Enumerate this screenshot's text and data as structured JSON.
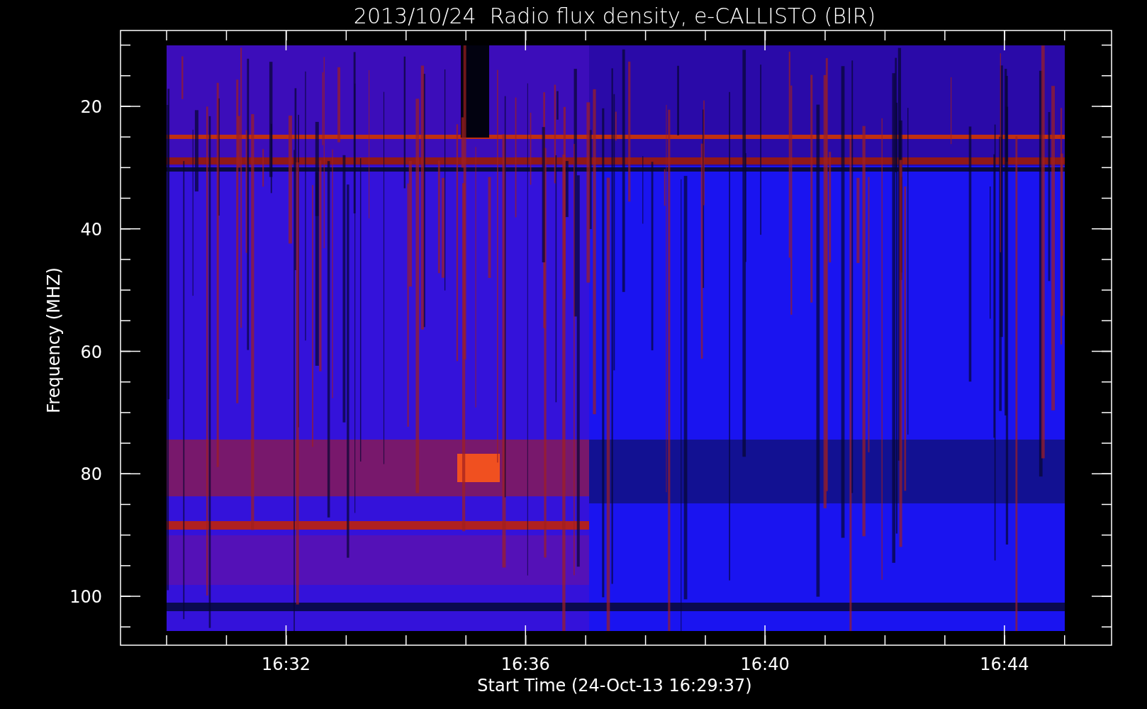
{
  "title": "2013/10/24  Radio flux density, e-CALLISTO (BIR)",
  "y_axis": {
    "label": "Frequency (MHZ)",
    "ticks": [
      "20",
      "40",
      "60",
      "80",
      "100"
    ]
  },
  "x_axis": {
    "label": "Start Time (24-Oct-13 16:29:37)",
    "ticks": [
      "16:32",
      "16:36",
      "16:40",
      "16:44"
    ]
  }
}
